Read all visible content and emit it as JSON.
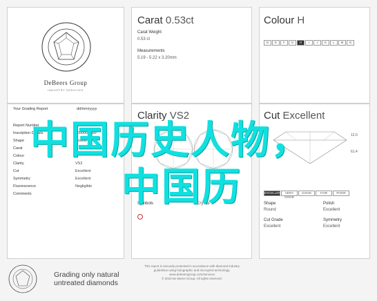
{
  "brand": {
    "seal_text": "INSTITUTE OF DIAMONDS",
    "name": "DeBeers Group",
    "subtitle": "INDUSTRY SERVICES"
  },
  "carat": {
    "heading": "Carat",
    "value": "0.53ct",
    "weight_label": "Carat Weight",
    "weight_value": "0.53 ct",
    "measure_label": "Measurements",
    "measure_value": "5.19 - 5.22 x 3.20mm"
  },
  "colour": {
    "heading": "Colour",
    "value": "H",
    "scale": [
      "D",
      "E",
      "F",
      "G",
      "H",
      "I",
      "J",
      "K",
      "L",
      "M",
      "N"
    ],
    "active": "H"
  },
  "report": {
    "title": "Your Grading Report",
    "date": "dd/mm/yyyy",
    "rows": [
      {
        "k": "Report Number",
        "v": "0000000000"
      },
      {
        "k": "Inscription Details",
        "v": "0000000000"
      },
      {
        "k": "Shape",
        "v": "Round"
      },
      {
        "k": "Carat",
        "v": "0.53 ct"
      },
      {
        "k": "Colour",
        "v": "H"
      },
      {
        "k": "Clarity",
        "v": "VS2"
      },
      {
        "k": "Cut",
        "v": "Excellent"
      },
      {
        "k": "Symmetry",
        "v": "Excellent"
      },
      {
        "k": "Fluorescence",
        "v": "Negligible"
      },
      {
        "k": "Comments",
        "v": ""
      }
    ]
  },
  "clarity": {
    "heading": "Clarity",
    "value": "VS2",
    "symbols_label": "Symbols",
    "symbols_value": "Crystal"
  },
  "cut": {
    "heading": "Cut",
    "value": "Excellent",
    "scale": [
      "EXCELLENT",
      "VERY GOOD",
      "GOOD",
      "FAIR",
      "POOR"
    ],
    "active": "EXCELLENT",
    "shape_label": "Shape",
    "shape_value": "Round",
    "polish_label": "Polish",
    "polish_value": "Excellent",
    "cutgrade_label": "Cut Grade",
    "cutgrade_value": "Excellent",
    "symmetry_label": "Symmetry",
    "symmetry_value": "Excellent",
    "measure_a": "12.0",
    "measure_b": "61.4"
  },
  "footer": {
    "grading_line1": "Grading only natural",
    "grading_line2": "untreated diamonds",
    "note_line1": "This report is securely protected in accordance with diamond industry",
    "note_line2": "guidelines using holographic and microprint technology.",
    "note_line3": "www.debeersgroup.com/services",
    "note_line4": "© 2019 De Beers Group. All rights reserved."
  },
  "overlay": {
    "line1": "中国历史人物，",
    "line2": "中国历"
  }
}
